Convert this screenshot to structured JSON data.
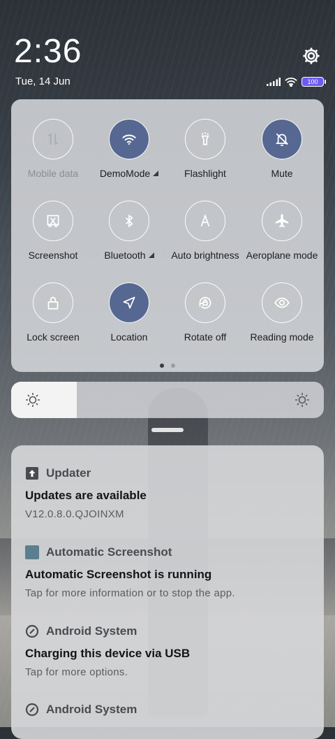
{
  "status": {
    "time": "2:36",
    "date": "Tue, 14 Jun",
    "battery": "100"
  },
  "quick_settings": {
    "tiles": [
      {
        "label": "Mobile data",
        "icon": "mobile-data-icon",
        "active": false,
        "disabled": true
      },
      {
        "label": "DemoMode",
        "icon": "wifi-icon",
        "active": true,
        "has_menu": true
      },
      {
        "label": "Flashlight",
        "icon": "flashlight-icon",
        "active": false
      },
      {
        "label": "Mute",
        "icon": "bell-off-icon",
        "active": true
      },
      {
        "label": "Screenshot",
        "icon": "screenshot-icon",
        "active": false
      },
      {
        "label": "Bluetooth",
        "icon": "bluetooth-icon",
        "active": false,
        "has_menu": true
      },
      {
        "label": "Auto brightness",
        "icon": "auto-brightness-icon",
        "active": false
      },
      {
        "label": "Aeroplane mode",
        "icon": "airplane-icon",
        "active": false
      },
      {
        "label": "Lock screen",
        "icon": "lock-icon",
        "active": false
      },
      {
        "label": "Location",
        "icon": "location-icon",
        "active": true
      },
      {
        "label": "Rotate off",
        "icon": "rotate-lock-icon",
        "active": false
      },
      {
        "label": "Reading mode",
        "icon": "eye-icon",
        "active": false
      }
    ],
    "page_count": 2,
    "current_page": 1
  },
  "brightness": {
    "level": 0.21
  },
  "notifications": [
    {
      "app": "Updater",
      "app_icon": "update-arrow-icon",
      "title": "Updates are available",
      "body": "V12.0.8.0.QJOINXM"
    },
    {
      "app": "Automatic Screenshot",
      "app_icon": "app-square-icon",
      "title": "Automatic Screenshot is running",
      "body": "Tap for more information or to stop the app."
    },
    {
      "app": "Android System",
      "app_icon": "android-system-icon",
      "title": "Charging this device via USB",
      "body": "Tap for more options."
    },
    {
      "app": "Android System",
      "app_icon": "android-system-icon",
      "title": "",
      "body": ""
    }
  ],
  "colors": {
    "active_tile": "#566892",
    "battery_fill": "#6b5cf0"
  }
}
